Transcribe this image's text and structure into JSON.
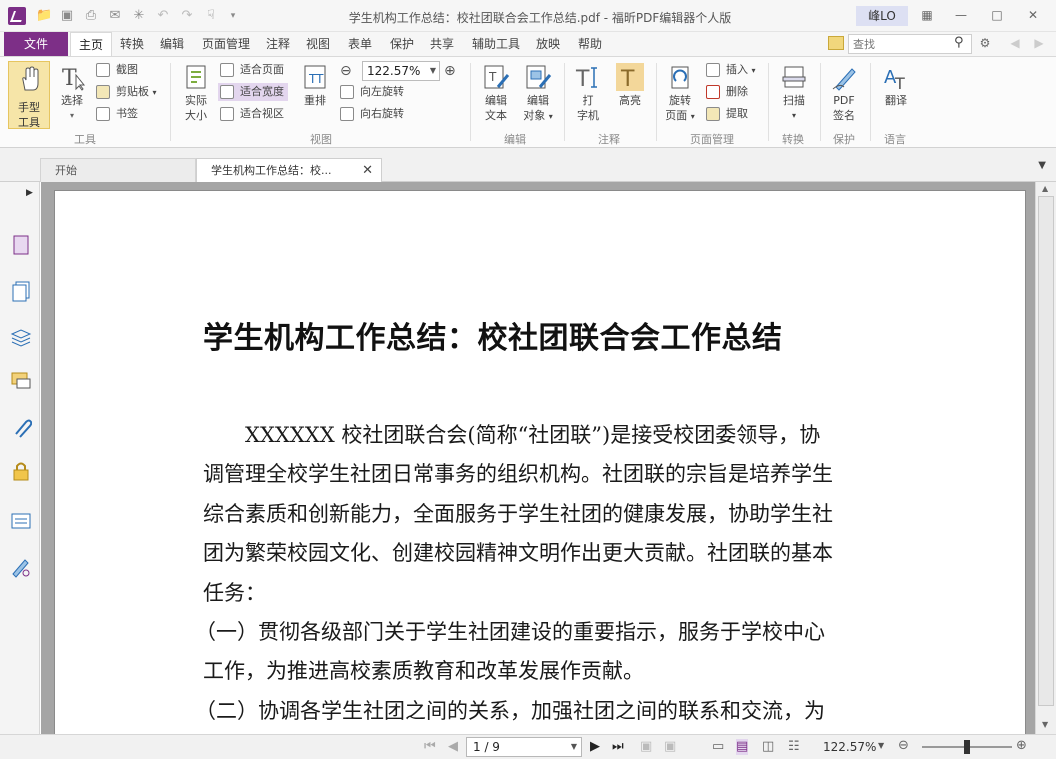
{
  "window": {
    "title": "学生机构工作总结：校社团联合会工作总结.pdf - 福昕PDF编辑器个人版",
    "user": "峰LO"
  },
  "menu": {
    "file": "文件",
    "tabs": [
      "主页",
      "转换",
      "编辑",
      "页面管理",
      "注释",
      "视图",
      "表单",
      "保护",
      "共享",
      "辅助工具",
      "放映",
      "帮助"
    ],
    "search_placeholder": "查找"
  },
  "ribbon": {
    "tools": {
      "hand": "手型\n工具",
      "hand_l1": "手型",
      "hand_l2": "工具",
      "select": "选择",
      "screenshot": "截图",
      "clipboard": "剪贴板",
      "bookmark": "书签",
      "group": "工具"
    },
    "view": {
      "actual_l1": "实际",
      "actual_l2": "大小",
      "fit_page": "适合页面",
      "fit_width": "适合宽度",
      "fit_visible": "适合视区",
      "reflow": "重排",
      "zoom": "122.57%",
      "rotate_left": "向左旋转",
      "rotate_right": "向右旋转",
      "group": "视图"
    },
    "edit": {
      "edit_text_l1": "编辑",
      "edit_text_l2": "文本",
      "edit_obj_l1": "编辑",
      "edit_obj_l2": "对象",
      "group": "编辑"
    },
    "comment": {
      "typewriter_l1": "打",
      "typewriter_l2": "字机",
      "highlight": "高亮",
      "group": "注释"
    },
    "pages": {
      "rotate_l1": "旋转",
      "rotate_l2": "页面",
      "insert": "插入",
      "delete": "删除",
      "extract": "提取",
      "group": "页面管理"
    },
    "convert": {
      "scan": "扫描",
      "group": "转换"
    },
    "protect": {
      "sign_l1": "PDF",
      "sign_l2": "签名",
      "group": "保护"
    },
    "language": {
      "translate": "翻译",
      "group": "语言"
    }
  },
  "doc_tabs": {
    "start": "开始",
    "current": "学生机构工作总结：校..."
  },
  "document": {
    "title": "学生机构工作总结：校社团联合会工作总结",
    "lines": [
      "　　XXXXXX 校社团联合会(简称“社团联”)是接受校团委领导，协",
      "调管理全校学生社团日常事务的组织机构。社团联的宗旨是培养学生",
      "综合素质和创新能力，全面服务于学生社团的健康发展，协助学生社",
      "团为繁荣校园文化、创建校园精神文明作出更大贡献。社团联的基本",
      "任务：",
      "（一）贯彻各级部门关于学生社团建设的重要指示，服务于学校中心",
      "工作，为推进高校素质教育和改革发展作贡献。",
      "（二）协调各学生社团之间的关系，加强社团之间的联系和交流，为"
    ]
  },
  "status": {
    "page": "1 / 9",
    "zoom": "122.57%"
  },
  "colors": {
    "accent": "#7d2f87",
    "highlight_btn": "#f6e5a8"
  }
}
